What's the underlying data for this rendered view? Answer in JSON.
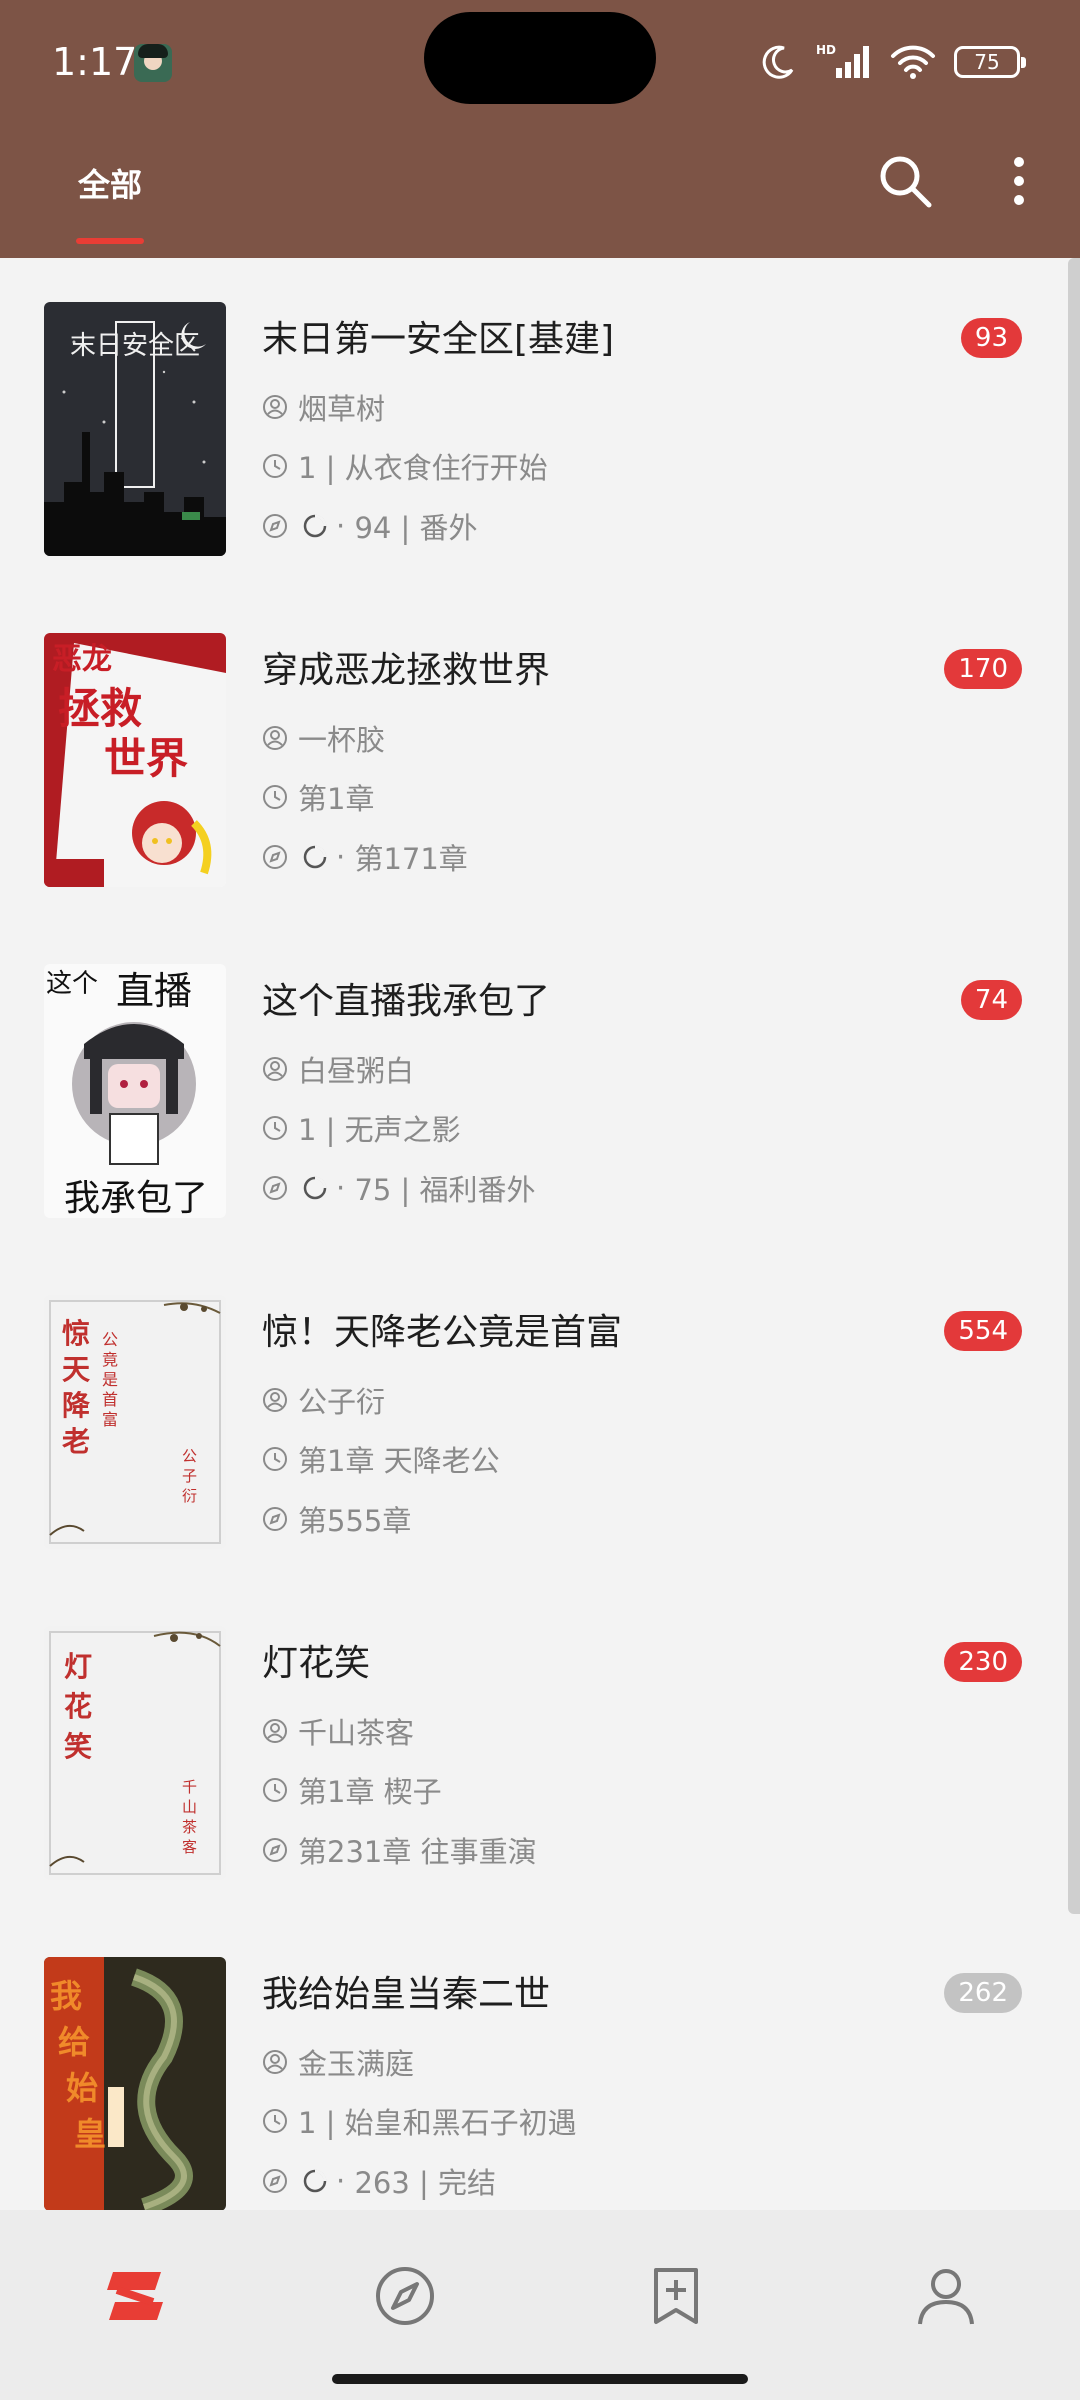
{
  "status_bar": {
    "time": "1:17",
    "network_label": "HD",
    "battery": "75"
  },
  "header": {
    "tab_all": "全部",
    "search_icon": "search-icon",
    "more_icon": "more-vert-icon"
  },
  "colors": {
    "header_bg": "#7d5446",
    "accent": "#e83d35",
    "badge_grey": "#c3c3c3"
  },
  "books": [
    {
      "title": "末日第一安全区[基建]",
      "author": "烟草树",
      "read": "1 | 从衣食住行开始",
      "latest": "94 | 番外",
      "latest_prefix": "·",
      "show_moon": true,
      "badge": "93",
      "badge_grey": false,
      "cover_text": "末日安全区"
    },
    {
      "title": "穿成恶龙拯救世界",
      "author": "一杯胶",
      "read": "第1章",
      "latest": "第171章",
      "latest_prefix": "·",
      "show_moon": true,
      "badge": "170",
      "badge_grey": false,
      "cover_text": "恶龙拯救世界"
    },
    {
      "title": "这个直播我承包了",
      "author": "白昼粥白",
      "read": "1 | 无声之影",
      "latest": "75 | 福利番外",
      "latest_prefix": "·",
      "show_moon": true,
      "badge": "74",
      "badge_grey": false,
      "cover_text": "这个直播我承包了"
    },
    {
      "title": "惊！天降老公竟是首富",
      "author": "公子衍",
      "read": "第1章 天降老公",
      "latest": "第555章",
      "latest_prefix": "",
      "show_moon": false,
      "badge": "554",
      "badge_grey": false,
      "cover_text": "惊天降老"
    },
    {
      "title": "灯花笑",
      "author": "千山茶客",
      "read": "第1章 楔子",
      "latest": "第231章 往事重演",
      "latest_prefix": "",
      "show_moon": false,
      "badge": "230",
      "badge_grey": false,
      "cover_text": "灯花笑"
    },
    {
      "title": "我给始皇当秦二世",
      "author": "金玉满庭",
      "read": "1 | 始皇和黑石子初遇",
      "latest": "263 | 完结",
      "latest_prefix": "·",
      "show_moon": true,
      "badge": "262",
      "badge_grey": true,
      "cover_text": "我给始皇"
    }
  ],
  "bottom_nav": [
    {
      "name": "bookshelf",
      "icon": "bookshelf-icon",
      "active": true
    },
    {
      "name": "explore",
      "icon": "compass-icon",
      "active": false
    },
    {
      "name": "rss",
      "icon": "bookmark-add-icon",
      "active": false
    },
    {
      "name": "profile",
      "icon": "person-icon",
      "active": false
    }
  ]
}
